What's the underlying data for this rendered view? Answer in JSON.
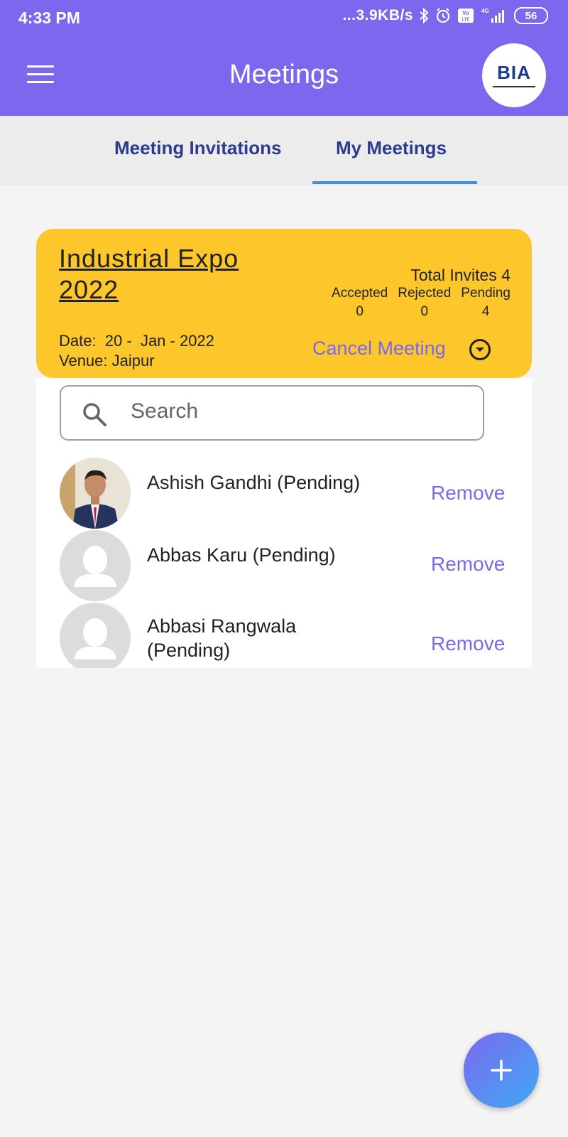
{
  "status_bar": {
    "time": "4:33 PM",
    "network_speed": "...3.9KB/s",
    "signal_label": "4G",
    "volte_label": "Vo LTE",
    "battery": "56"
  },
  "header": {
    "title": "Meetings",
    "logo_text": "BIA",
    "colors": {
      "background": "#7b68ee"
    }
  },
  "tabs": [
    {
      "label": "Meeting Invitations",
      "active": false
    },
    {
      "label": "My Meetings",
      "active": true
    }
  ],
  "meeting": {
    "title": "Industrial Expo 2022",
    "total_invites_label": "Total Invites 4",
    "stats": [
      {
        "label": "Accepted",
        "value": "0"
      },
      {
        "label": "Rejected",
        "value": "0"
      },
      {
        "label": "Pending",
        "value": "4"
      }
    ],
    "date_line": "Date:  20 -  Jan - 2022",
    "venue_line": "Venue: Jaipur",
    "cancel_label": "Cancel Meeting",
    "colors": {
      "card": "#fdc72c",
      "accent": "#7b68ee"
    }
  },
  "search": {
    "placeholder": "Search",
    "value": ""
  },
  "invitees": [
    {
      "name": "Ashish Gandhi (Pending)",
      "remove_label": "Remove",
      "avatar": "photo"
    },
    {
      "name": "Abbas Karu (Pending)",
      "remove_label": "Remove",
      "avatar": "placeholder-person-icon"
    },
    {
      "name": "Abbasi Rangwala (Pending)",
      "remove_label": "Remove",
      "avatar": "placeholder-person-icon"
    }
  ],
  "fab": {
    "icon": "plus-icon"
  }
}
